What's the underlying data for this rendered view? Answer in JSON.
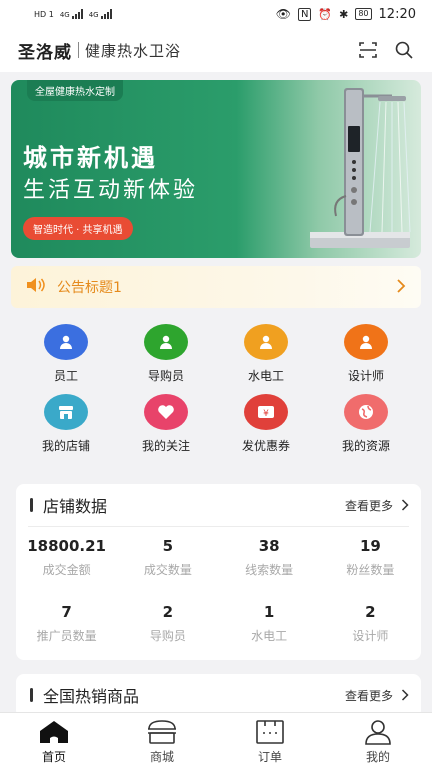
{
  "status_bar": {
    "network": "HD 1",
    "signal1": "4G",
    "signal2": "4G",
    "battery": "80",
    "time": "12:20"
  },
  "header": {
    "brand": "圣洛威",
    "slogan": "健康热水卫浴"
  },
  "banner": {
    "tag": "全屋健康热水定制",
    "line1": "城市新机遇",
    "line2": "生活互动新体验",
    "pill": "智造时代 · 共享机遇"
  },
  "notice": {
    "text": "公告标题1"
  },
  "quick_menu": [
    {
      "label": "员工",
      "icon": "user-icon",
      "color": "#3b6fe0"
    },
    {
      "label": "导购员",
      "icon": "user-icon",
      "color": "#2ea52e"
    },
    {
      "label": "水电工",
      "icon": "user-icon",
      "color": "#f0a020"
    },
    {
      "label": "设计师",
      "icon": "user-icon",
      "color": "#f07318"
    },
    {
      "label": "我的店铺",
      "icon": "store-icon",
      "color": "#3aa9c9"
    },
    {
      "label": "我的关注",
      "icon": "heart-icon",
      "color": "#e8436a"
    },
    {
      "label": "发优惠券",
      "icon": "coupon-icon",
      "color": "#e0403a"
    },
    {
      "label": "我的资源",
      "icon": "globe-icon",
      "color": "#f06c6c"
    }
  ],
  "store_data": {
    "title": "店铺数据",
    "more": "查看更多",
    "stats": [
      {
        "value": "18800.21",
        "label": "成交金额"
      },
      {
        "value": "5",
        "label": "成交数量"
      },
      {
        "value": "38",
        "label": "线索数量"
      },
      {
        "value": "19",
        "label": "粉丝数量"
      },
      {
        "value": "7",
        "label": "推广员数量"
      },
      {
        "value": "2",
        "label": "导购员"
      },
      {
        "value": "1",
        "label": "水电工"
      },
      {
        "value": "2",
        "label": "设计师"
      }
    ]
  },
  "hot_products": {
    "title": "全国热销商品",
    "more": "查看更多"
  },
  "tabbar": [
    {
      "label": "首页",
      "icon": "home-icon",
      "active": true
    },
    {
      "label": "商城",
      "icon": "shop-icon",
      "active": false
    },
    {
      "label": "订单",
      "icon": "order-icon",
      "active": false
    },
    {
      "label": "我的",
      "icon": "profile-icon",
      "active": false
    }
  ]
}
